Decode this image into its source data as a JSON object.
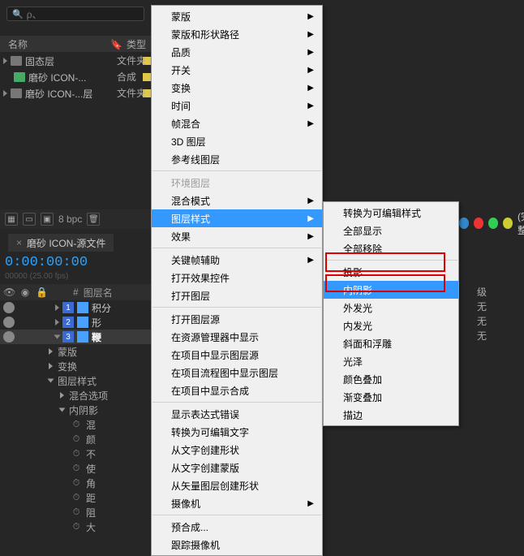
{
  "search": {
    "placeholder": "ρ、"
  },
  "project": {
    "columns": {
      "name": "名称",
      "type": "类型"
    },
    "rows": [
      {
        "name": "固态层",
        "type": "文件夹",
        "color": "#e0c84a"
      },
      {
        "name": "磨砂 ICON-...",
        "type": "合成",
        "color": "#e0c84a"
      },
      {
        "name": "磨砂 ICON-...层",
        "type": "文件夹",
        "color": "#e0c84a"
      }
    ]
  },
  "statusbar": {
    "bpc": "8 bpc"
  },
  "comp": {
    "tab": "磨砂 ICON-源文件",
    "timecode": "0:00:00:00",
    "fps": "00000 (25.00 fps)"
  },
  "timeline": {
    "columns": {
      "num": "#",
      "layername": "图层名"
    },
    "layers": [
      {
        "idx": "1",
        "name": "积分"
      },
      {
        "idx": "2",
        "name": "形"
      },
      {
        "idx": "3",
        "name": "鞭"
      }
    ],
    "tree": {
      "masks": "蒙版",
      "transform": "变换",
      "layerstyles": "图层样式",
      "blendopts": "混合选项",
      "innershadow": "内阴影",
      "props": [
        "混",
        "颜",
        "不",
        "使",
        "角",
        "距",
        "阻",
        "大"
      ]
    },
    "rightlabel_parent": "级",
    "rightlabel_none": "无"
  },
  "topright_label": "(完整",
  "menu_main": {
    "items": [
      {
        "id": "masks",
        "label": "蒙版",
        "sub": true
      },
      {
        "id": "maskpath",
        "label": "蒙版和形状路径",
        "sub": true
      },
      {
        "id": "quality",
        "label": "品质",
        "sub": true
      },
      {
        "id": "switches",
        "label": "开关",
        "sub": true
      },
      {
        "id": "transform",
        "label": "变换",
        "sub": true
      },
      {
        "id": "time",
        "label": "时间",
        "sub": true
      },
      {
        "id": "frameblend",
        "label": "帧混合",
        "sub": true
      },
      {
        "id": "3dlayer",
        "label": "3D 图层"
      },
      {
        "id": "guidelayer",
        "label": "参考线图层"
      },
      {
        "id": "envlayer",
        "label": "环境图层",
        "disabled": true
      },
      {
        "id": "blendmode",
        "label": "混合模式",
        "sub": true
      },
      {
        "id": "layerstyles",
        "label": "图层样式",
        "sub": true,
        "hl": true
      },
      {
        "id": "effect",
        "label": "效果",
        "sub": true
      },
      {
        "id": "keyframeassist",
        "label": "关键帧辅助",
        "sub": true
      },
      {
        "id": "openeffect",
        "label": "打开效果控件"
      },
      {
        "id": "openlayer",
        "label": "打开图层"
      },
      {
        "id": "openlayersrc",
        "label": "打开图层源"
      },
      {
        "id": "reveal-explorer",
        "label": "在资源管理器中显示"
      },
      {
        "id": "reveal-proj",
        "label": "在项目中显示图层源"
      },
      {
        "id": "reveal-flow",
        "label": "在项目流程图中显示图层"
      },
      {
        "id": "reveal-comp",
        "label": "在项目中显示合成"
      },
      {
        "id": "show-expr-err",
        "label": "显示表达式错误"
      },
      {
        "id": "convert-text",
        "label": "转换为可编辑文字"
      },
      {
        "id": "shapes-from-text",
        "label": "从文字创建形状"
      },
      {
        "id": "masks-from-text",
        "label": "从文字创建蒙版"
      },
      {
        "id": "shapes-from-vector",
        "label": "从矢量图层创建形状"
      },
      {
        "id": "camera",
        "label": "摄像机",
        "sub": true
      },
      {
        "id": "precompose",
        "label": "预合成..."
      },
      {
        "id": "track-camera",
        "label": "跟踪摄像机"
      }
    ]
  },
  "menu_styles": {
    "items": [
      {
        "id": "convert-editable",
        "label": "转换为可编辑样式"
      },
      {
        "id": "show-all",
        "label": "全部显示"
      },
      {
        "id": "remove-all",
        "label": "全部移除"
      },
      {
        "id": "drop-shadow",
        "label": "投影"
      },
      {
        "id": "inner-shadow",
        "label": "内阴影",
        "hl": true
      },
      {
        "id": "outer-glow",
        "label": "外发光"
      },
      {
        "id": "inner-glow",
        "label": "内发光"
      },
      {
        "id": "bevel",
        "label": "斜面和浮雕"
      },
      {
        "id": "satin",
        "label": "光泽"
      },
      {
        "id": "color-overlay",
        "label": "颜色叠加"
      },
      {
        "id": "gradient-overlay",
        "label": "渐变叠加"
      },
      {
        "id": "stroke",
        "label": "描边"
      }
    ]
  }
}
